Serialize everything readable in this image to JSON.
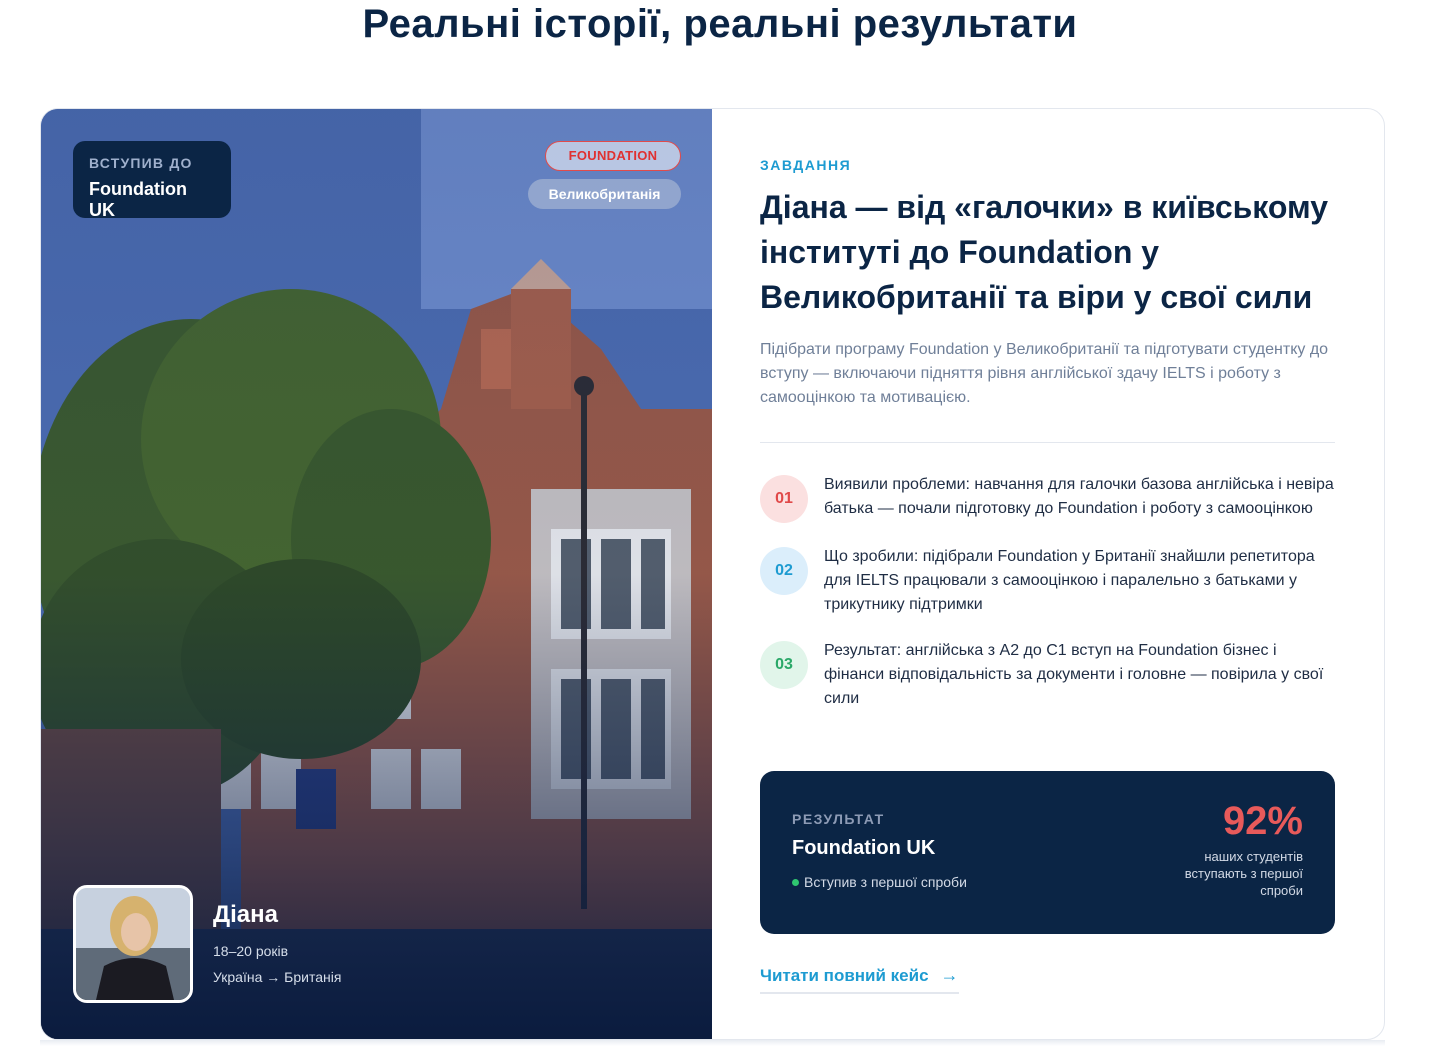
{
  "section": {
    "title": "Реальні історії, реальні результати"
  },
  "photo_panel": {
    "admitted_small": "ВСТУПИВ ДО",
    "admitted_big": "Foundation UK",
    "tag_program": "FOUNDATION",
    "tag_country": "Великобританія",
    "student": {
      "name": "Діана",
      "age": "18–20 років",
      "route": "Україна → Британія"
    }
  },
  "case": {
    "eyebrow": "ЗАВДАННЯ",
    "headline": "Діана — від «галочки» в київському інституті до Foundation у Великобританії та віри у свої сили",
    "task": "Підібрати програму Foundation у Великобританії та підготувати студентку до вступу — включаючи підняття рівня англійської здачу IELTS і роботу з самооцінкою та мотивацією.",
    "steps": [
      {
        "num": "01",
        "text": "Виявили проблеми: навчання для галочки базова англійська і невіра батька — почали підготовку до Foundation і роботу з самооцінкою",
        "color": "#e04848"
      },
      {
        "num": "02",
        "text": "Що зробили: підібрали Foundation у Британії знайшли репетитора для IELTS працювали з самооцінкою і паралельно з батьками у трикутнику підтримки",
        "color": "#1d9bd1"
      },
      {
        "num": "03",
        "text": "Результат: англійська з А2 до С1 вступ на Foundation бізнес і фінанси відповідальність за документи і головне — повірила у свої сили",
        "color": "#2aa868"
      }
    ],
    "result": {
      "label": "РЕЗУЛЬТАТ",
      "title": "Foundation UK",
      "sub": "Вступив з першої спроби",
      "percent": "92%",
      "caption": "наших студентів вступають з першої спроби"
    },
    "link": "Читати повний кейс",
    "link_arrow": "→"
  },
  "colors": {
    "navy": "#0b2545",
    "accent_blue": "#1d9bd1",
    "accent_red": "#e85a5a",
    "accent_green": "#2fc770"
  }
}
